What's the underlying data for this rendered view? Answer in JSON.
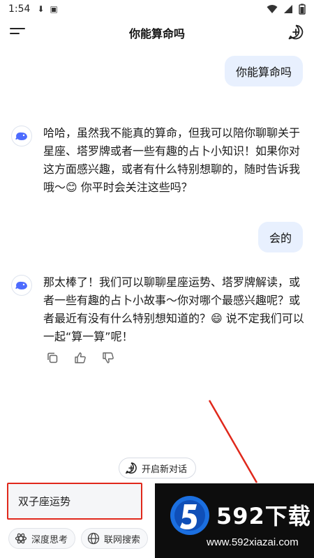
{
  "status_bar": {
    "time": "1:54"
  },
  "header": {
    "title": "你能算命吗"
  },
  "messages": [
    {
      "role": "user",
      "text": "你能算命吗"
    },
    {
      "role": "ai",
      "text": "哈哈，虽然我不能真的算命，但我可以陪你聊聊关于星座、塔罗牌或者一些有趣的占卜小知识！如果你对这方面感兴趣，或者有什么特别想聊的，随时告诉我哦～😊 你平时会关注这些吗？"
    },
    {
      "role": "user",
      "text": "会的"
    },
    {
      "role": "ai",
      "text": "那太棒了！我们可以聊聊星座运势、塔罗牌解读，或者一些有趣的占卜小故事～你对哪个最感兴趣呢？或者最近有没有什么特别想知道的？😄 说不定我们可以一起“算一算”呢！"
    }
  ],
  "new_chat_pill": {
    "label": "开启新对话"
  },
  "input": {
    "value": "双子座运势"
  },
  "modes": {
    "deep_think": "深度思考",
    "web_search": "联网搜索"
  },
  "watermark": {
    "brand": "592下载",
    "url": "www.592xiazai.com"
  },
  "colors": {
    "accent": "#4d6bfe",
    "user_bubble": "#e8f0fe",
    "highlight_border": "#e0281b"
  }
}
